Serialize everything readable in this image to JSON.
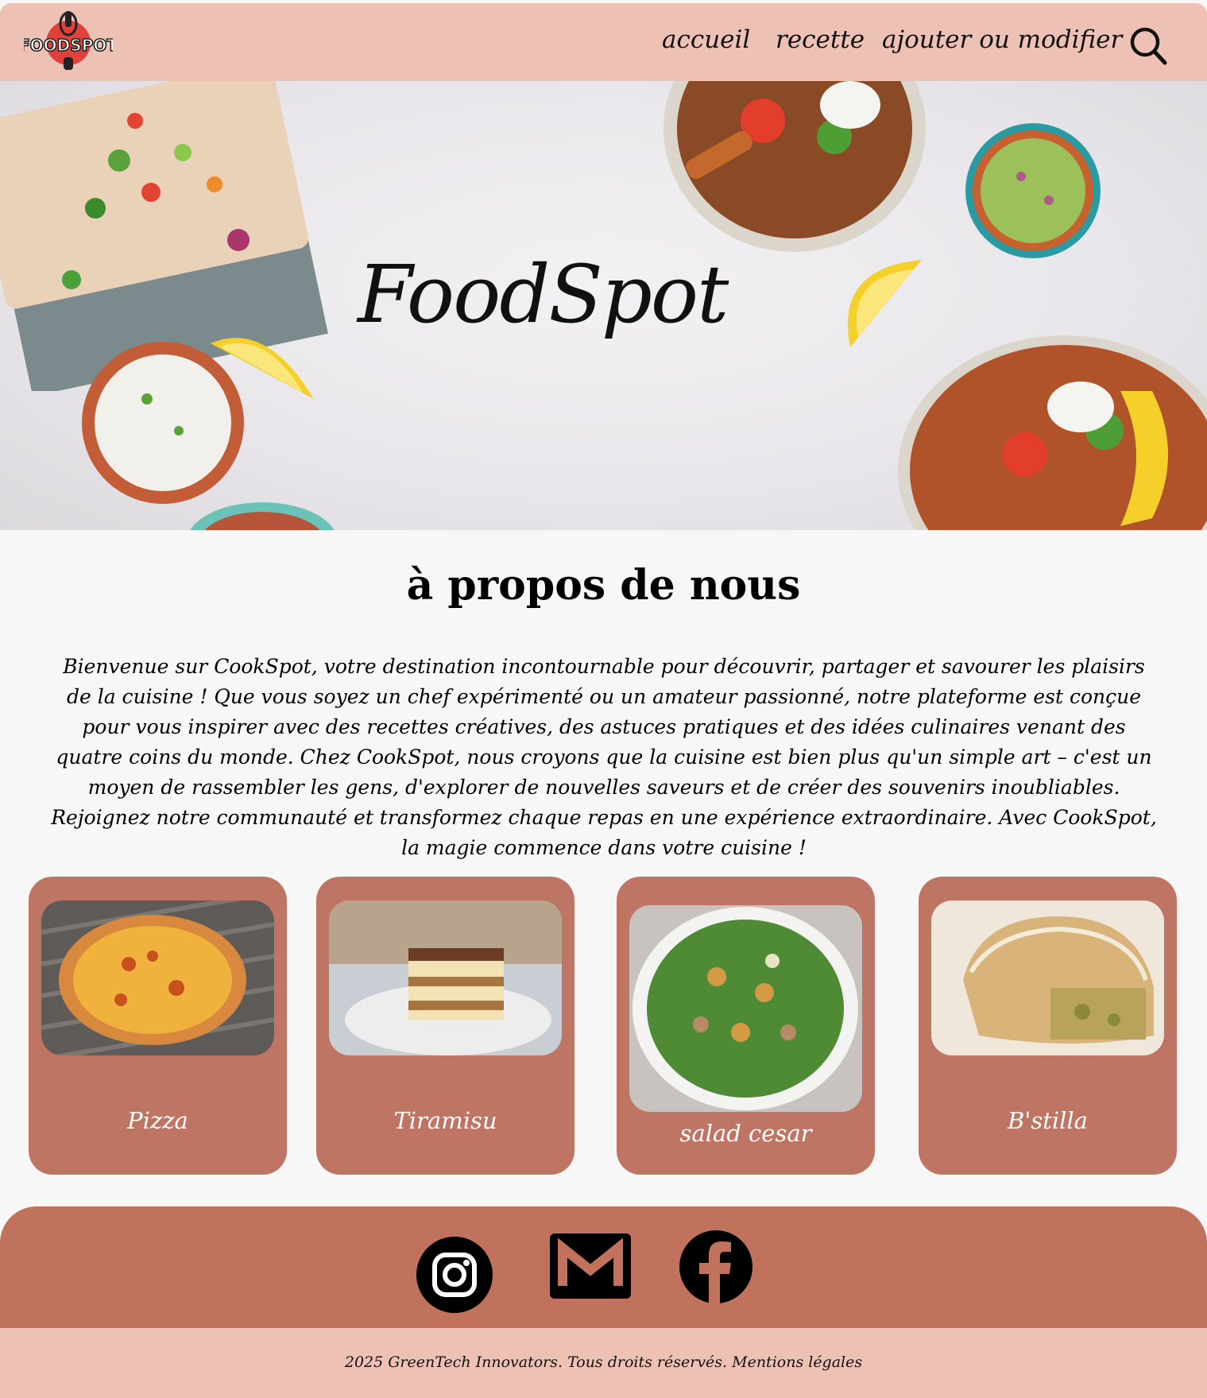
{
  "header": {
    "logo_text": "FOODSPOT",
    "nav": [
      "accueil",
      "recette",
      "ajouter ou modifier"
    ]
  },
  "hero": {
    "title": "FoodSpot"
  },
  "about": {
    "title": "à propos de nous",
    "text": "Bienvenue sur CookSpot, votre destination incontournable pour découvrir, partager et savourer les plaisirs de la cuisine ! Que vous soyez un chef expérimenté ou un amateur passionné, notre plateforme est conçue pour vous inspirer avec des recettes créatives, des astuces pratiques et des idées culinaires venant des quatre coins du monde. Chez CookSpot, nous croyons que la cuisine est bien plus qu'un simple art – c'est un moyen de rassembler les gens, d'explorer de nouvelles saveurs et de créer des souvenirs inoubliables. Rejoignez notre communauté et transformez chaque repas en une expérience extraordinaire. Avec CookSpot, la magie commence dans votre cuisine !"
  },
  "cards": [
    {
      "label": "Pizza",
      "image": "pizza-image"
    },
    {
      "label": "Tiramisu",
      "image": "tiramisu-image"
    },
    {
      "label": "salad cesar",
      "image": "caesar-salad-image"
    },
    {
      "label": "B'stilla",
      "image": "bstilla-image"
    }
  ],
  "footer": {
    "social_icons": [
      "instagram-icon",
      "mail-icon",
      "facebook-icon"
    ],
    "copyright": "2025 GreenTech Innovators. Tous droits réservés. Mentions légales"
  },
  "colors": {
    "header_bg": "#eec1b5",
    "card_bg": "#bf7563",
    "footer_bg": "#c0725d",
    "page_bg": "#f8f7f7"
  }
}
